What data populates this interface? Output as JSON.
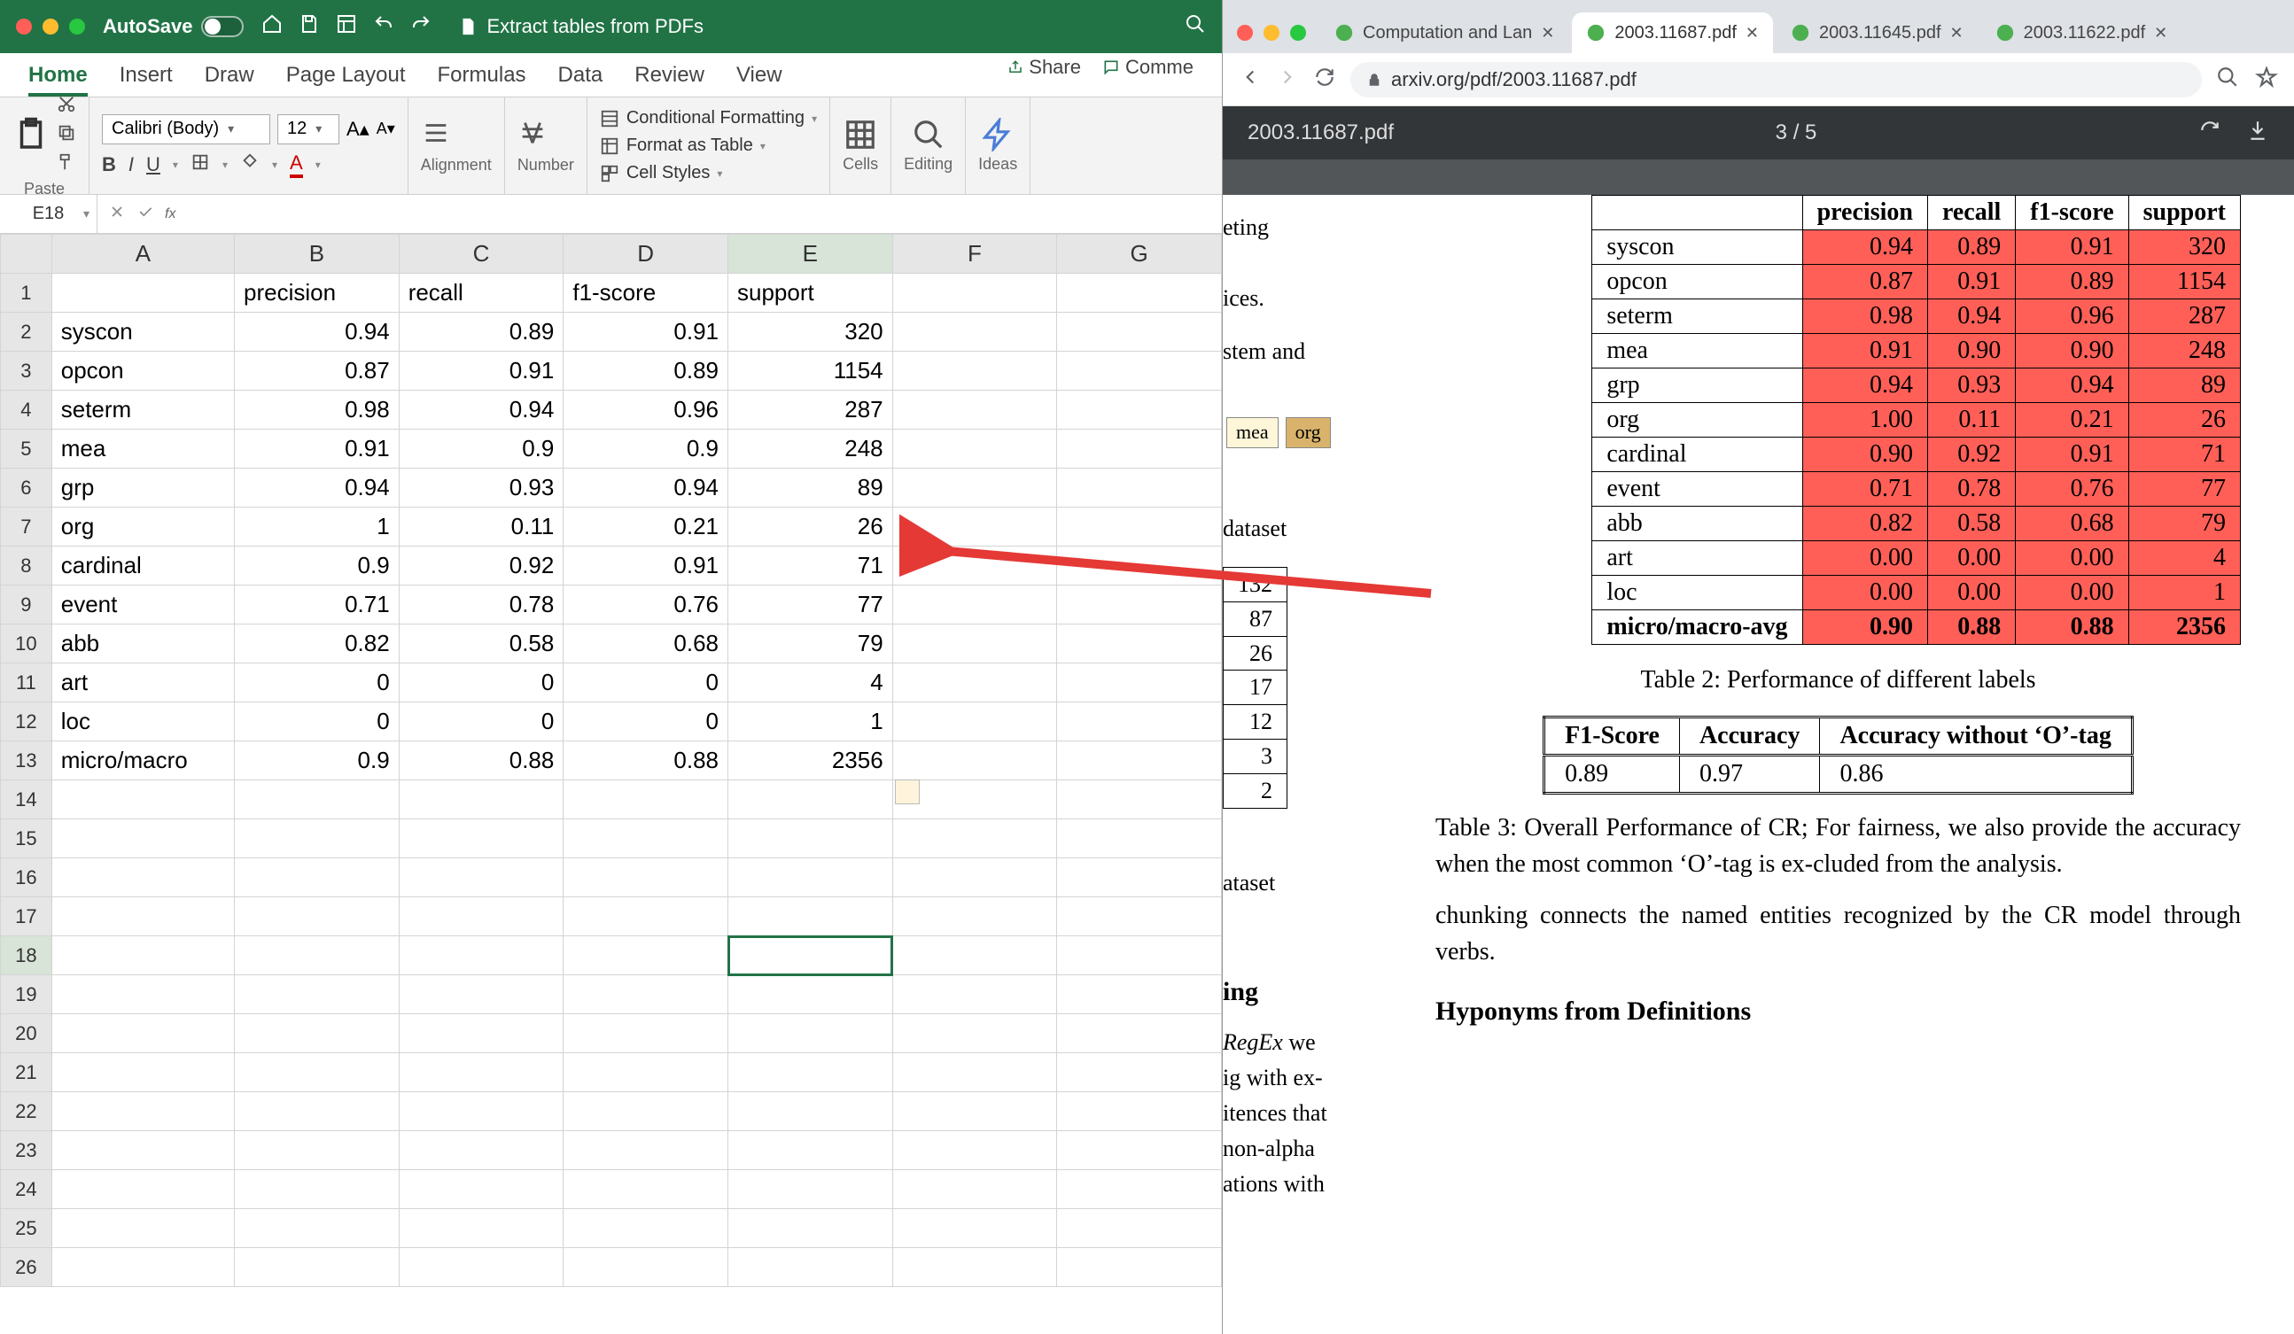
{
  "excel": {
    "autosave_label": "AutoSave",
    "doc_title": "Extract tables from PDFs",
    "ribbon_tabs": [
      "Home",
      "Insert",
      "Draw",
      "Page Layout",
      "Formulas",
      "Data",
      "Review",
      "View"
    ],
    "share_label": "Share",
    "comments_label": "Comme",
    "font_name": "Calibri (Body)",
    "font_size": "12",
    "group_labels": {
      "clipboard": "Paste",
      "alignment": "Alignment",
      "number": "Number",
      "cells": "Cells",
      "editing": "Editing",
      "ideas": "Ideas"
    },
    "cmd_cond": "Conditional Formatting",
    "cmd_fmt_table": "Format as Table",
    "cmd_cell_styles": "Cell Styles",
    "name_box": "E18",
    "fx_placeholder": "fx",
    "columns": [
      "A",
      "B",
      "C",
      "D",
      "E",
      "F",
      "G"
    ],
    "rows": 26,
    "selected_cell": {
      "row": 18,
      "col": "E"
    },
    "data": {
      "headers": [
        "",
        "precision",
        "recall",
        "f1-score",
        "support"
      ],
      "rows": [
        {
          "label": "syscon",
          "vals": [
            0.94,
            0.89,
            0.91,
            320
          ]
        },
        {
          "label": "opcon",
          "vals": [
            0.87,
            0.91,
            0.89,
            1154
          ]
        },
        {
          "label": "seterm",
          "vals": [
            0.98,
            0.94,
            0.96,
            287
          ]
        },
        {
          "label": "mea",
          "vals": [
            0.91,
            0.9,
            0.9,
            248
          ]
        },
        {
          "label": "grp",
          "vals": [
            0.94,
            0.93,
            0.94,
            89
          ]
        },
        {
          "label": "org",
          "vals": [
            1,
            0.11,
            0.21,
            26
          ]
        },
        {
          "label": "cardinal",
          "vals": [
            0.9,
            0.92,
            0.91,
            71
          ]
        },
        {
          "label": "event",
          "vals": [
            0.71,
            0.78,
            0.76,
            77
          ]
        },
        {
          "label": "abb",
          "vals": [
            0.82,
            0.58,
            0.68,
            79
          ]
        },
        {
          "label": "art",
          "vals": [
            0,
            0,
            0,
            4
          ]
        },
        {
          "label": "loc",
          "vals": [
            0,
            0,
            0,
            1
          ]
        },
        {
          "label": "micro/macro",
          "vals": [
            0.9,
            0.88,
            0.88,
            2356
          ]
        }
      ]
    }
  },
  "chrome": {
    "tabs": [
      {
        "title": "Computation and Lan",
        "active": false
      },
      {
        "title": "2003.11687.pdf",
        "active": true
      },
      {
        "title": "2003.11645.pdf",
        "active": false
      },
      {
        "title": "2003.11622.pdf",
        "active": false
      }
    ],
    "url": "arxiv.org/pdf/2003.11687.pdf"
  },
  "pdf": {
    "filename": "2003.11687.pdf",
    "page_indicator": "3 / 5",
    "fragments": {
      "f1": "eting",
      "f2": "ices.",
      "f3": "stem",
      "f3b": " and",
      "chip1": "mea",
      "chip2": "org",
      "f4": "dataset",
      "f5": "ing",
      "f6": "RegEx",
      "f6b": " we",
      "f7": "ig with ex-",
      "f8": "itences that",
      "f9": "non-alpha",
      "f10": "ations with",
      "f11": "ataset",
      "small_vals": [
        132,
        87,
        26,
        17,
        12,
        3,
        2
      ]
    },
    "table2": {
      "headers": [
        "",
        "precision",
        "recall",
        "f1-score",
        "support"
      ],
      "rows": [
        [
          "syscon",
          "0.94",
          "0.89",
          "0.91",
          "320"
        ],
        [
          "opcon",
          "0.87",
          "0.91",
          "0.89",
          "1154"
        ],
        [
          "seterm",
          "0.98",
          "0.94",
          "0.96",
          "287"
        ],
        [
          "mea",
          "0.91",
          "0.90",
          "0.90",
          "248"
        ],
        [
          "grp",
          "0.94",
          "0.93",
          "0.94",
          "89"
        ],
        [
          "org",
          "1.00",
          "0.11",
          "0.21",
          "26"
        ],
        [
          "cardinal",
          "0.90",
          "0.92",
          "0.91",
          "71"
        ],
        [
          "event",
          "0.71",
          "0.78",
          "0.76",
          "77"
        ],
        [
          "abb",
          "0.82",
          "0.58",
          "0.68",
          "79"
        ],
        [
          "art",
          "0.00",
          "0.00",
          "0.00",
          "4"
        ],
        [
          "loc",
          "0.00",
          "0.00",
          "0.00",
          "1"
        ],
        [
          "micro/macro-avg",
          "0.90",
          "0.88",
          "0.88",
          "2356"
        ]
      ],
      "caption": "Table 2: Performance of different labels"
    },
    "table3": {
      "headers": [
        "F1-Score",
        "Accuracy",
        "Accuracy without ‘O’-tag"
      ],
      "row": [
        "0.89",
        "0.97",
        "0.86"
      ],
      "caption": "Table 3: Overall Performance of CR; For fairness, we also provide the accuracy when the most common ‘O’-tag is ex-cluded from the analysis."
    },
    "para1": "chunking connects the named entities recognized by the CR model through verbs.",
    "heading": "Hyponyms from Definitions"
  }
}
